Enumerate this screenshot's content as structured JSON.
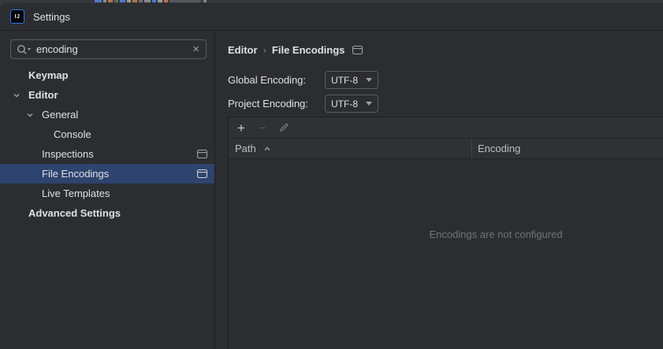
{
  "colors": {
    "dialog_bg": "#2B2D30",
    "band_bg": "#2F3134",
    "selection_bg": "#2E436E",
    "accent": "#3574F0",
    "border": "#1E1F22",
    "input_border": "#5A5D61",
    "text_primary": "#DFE1E5",
    "text_secondary": "#9DA0A8",
    "text_disabled": "#70747B"
  },
  "window": {
    "logo_text": "IJ",
    "title": "Settings"
  },
  "search": {
    "value": "encoding",
    "clear_glyph": "×"
  },
  "sidebar": {
    "tree": [
      {
        "label": "Keymap",
        "level": 1,
        "bold": true
      },
      {
        "label": "Editor",
        "level": 1,
        "bold": true,
        "expanded": true
      },
      {
        "label": "General",
        "level": 2,
        "expanded": true
      },
      {
        "label": "Console",
        "level": 3
      },
      {
        "label": "Inspections",
        "level": 2,
        "page_icon": true
      },
      {
        "label": "File Encodings",
        "level": 2,
        "page_icon": true,
        "selected": true
      },
      {
        "label": "Live Templates",
        "level": 2
      },
      {
        "label": "Advanced Settings",
        "level": 1,
        "bold": true
      }
    ]
  },
  "breadcrumb": {
    "parent": "Editor",
    "separator": "›",
    "current": "File Encodings"
  },
  "form": {
    "global_label": "Global Encoding:",
    "global_value": "UTF-8",
    "project_label": "Project Encoding:",
    "project_value": "UTF-8"
  },
  "toolbar": {
    "add_glyph": "+",
    "remove_glyph": "−",
    "buttons": [
      "add",
      "remove",
      "edit"
    ]
  },
  "table": {
    "columns": [
      "Path",
      "Encoding"
    ],
    "sort": {
      "column": "Path",
      "direction": "ascending"
    },
    "rows": [],
    "empty_text": "Encodings are not configured"
  }
}
